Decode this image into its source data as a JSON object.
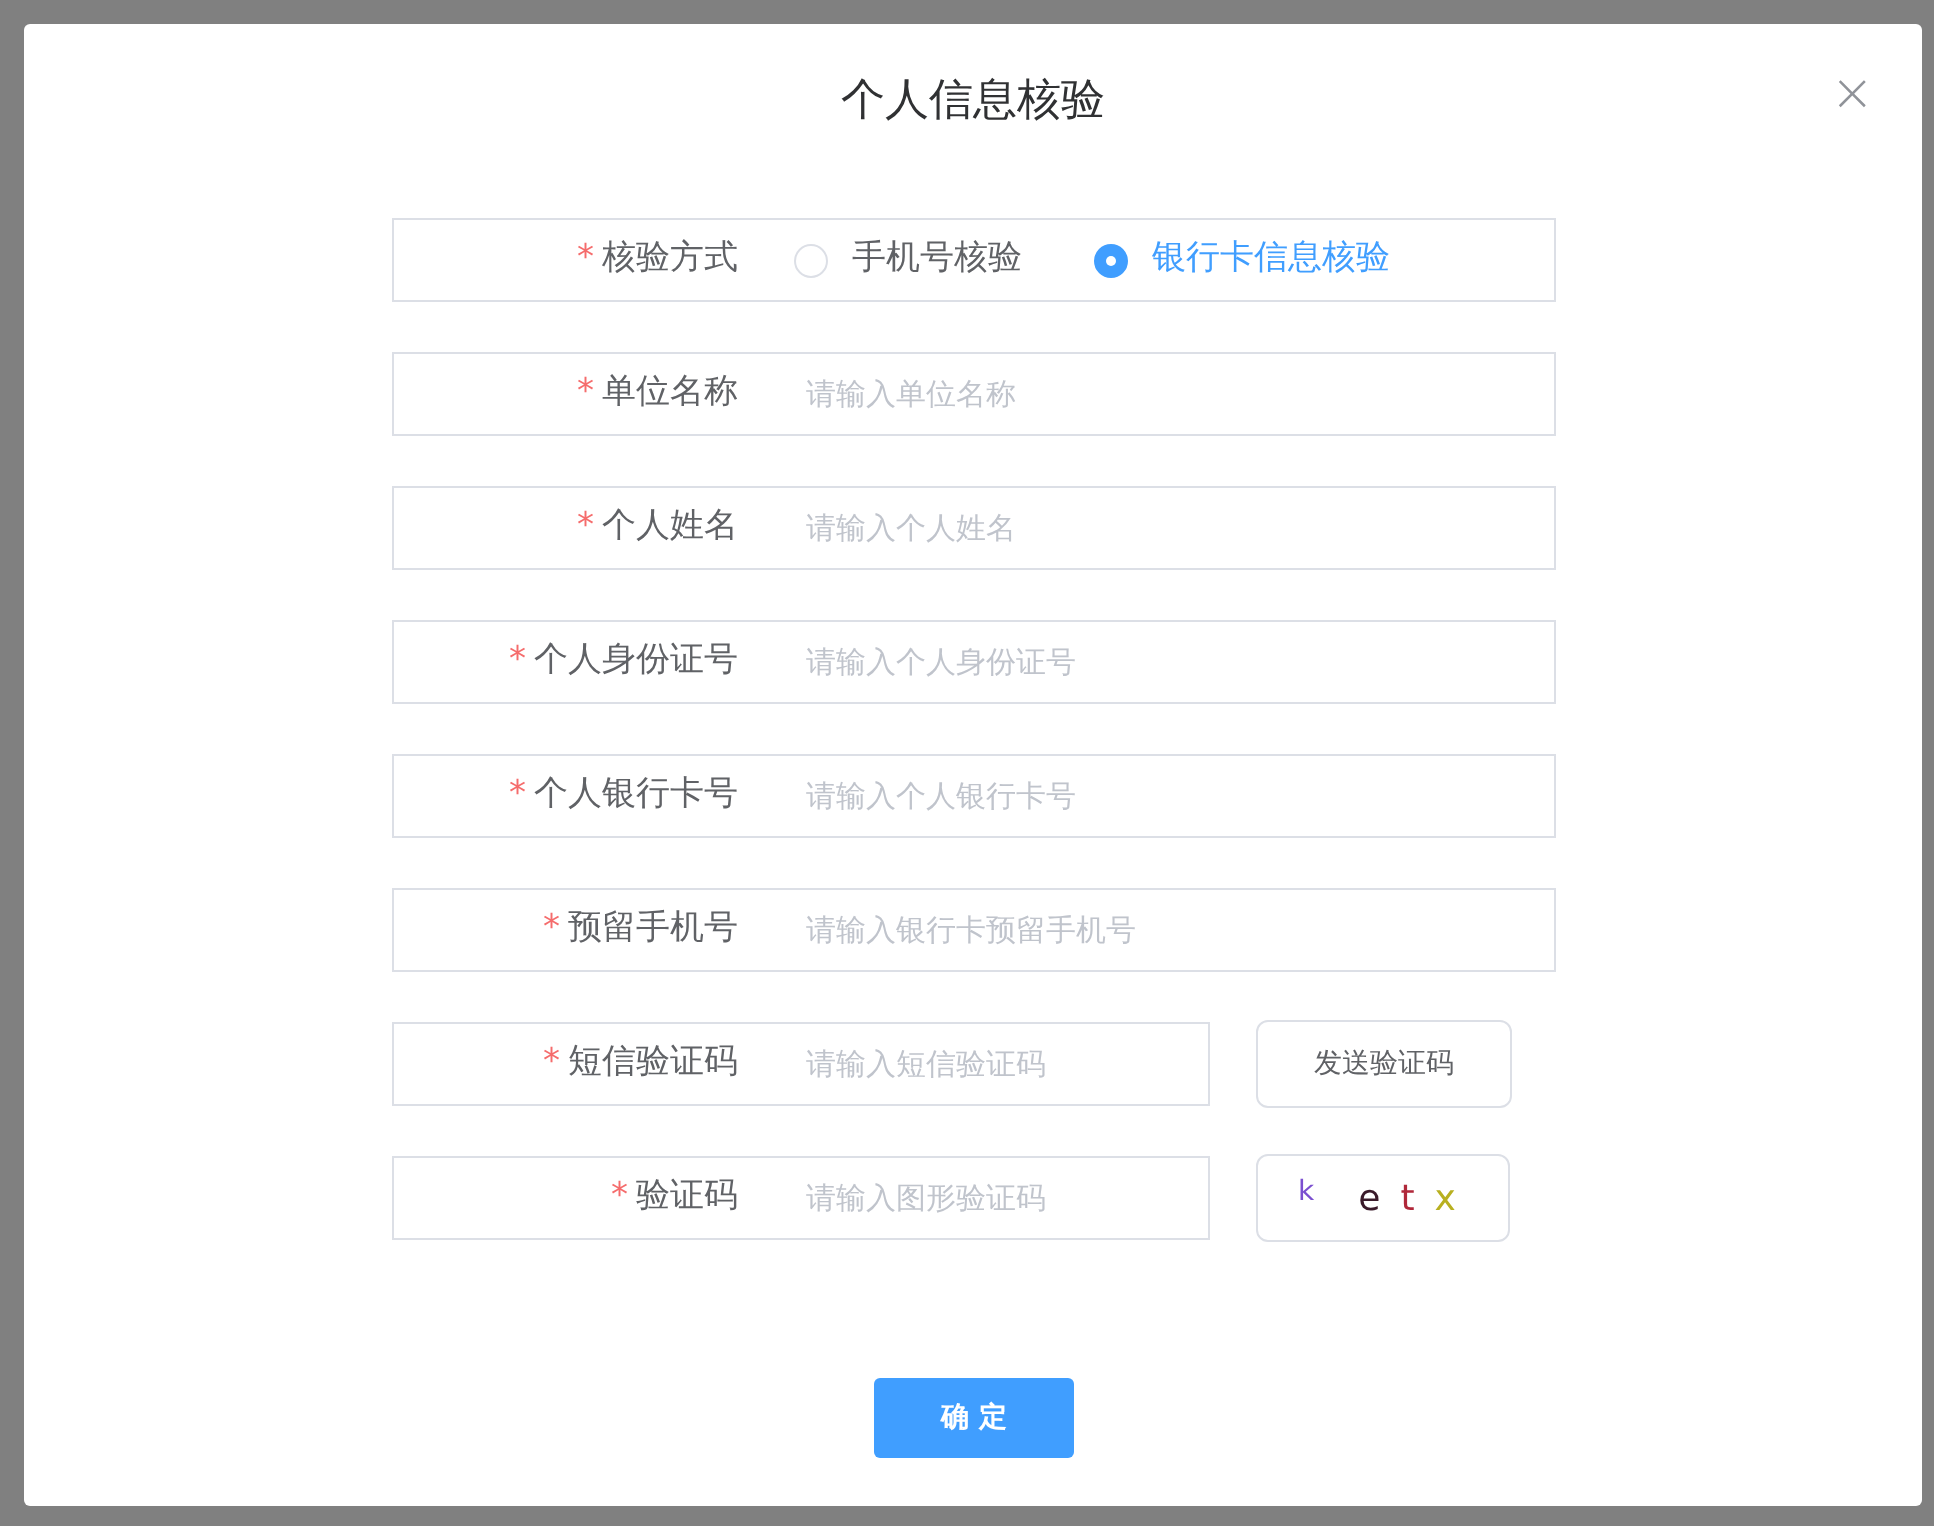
{
  "dialog": {
    "title": "个人信息核验",
    "close": "×"
  },
  "required_mark": "*",
  "fields": [
    {
      "kind": "radio",
      "label": "核验方式",
      "required": true,
      "options": [
        {
          "label": "手机号核验",
          "selected": false
        },
        {
          "label": "银行卡信息核验",
          "selected": true
        }
      ]
    },
    {
      "kind": "input",
      "label": "单位名称",
      "required": true,
      "placeholder": "请输入单位名称"
    },
    {
      "kind": "input",
      "label": "个人姓名",
      "required": true,
      "placeholder": "请输入个人姓名"
    },
    {
      "kind": "input",
      "label": "个人身份证号",
      "required": true,
      "placeholder": "请输入个人身份证号"
    },
    {
      "kind": "input",
      "label": "个人银行卡号",
      "required": true,
      "placeholder": "请输入个人银行卡号"
    },
    {
      "kind": "input",
      "label": "预留手机号",
      "required": true,
      "placeholder": "请输入银行卡预留手机号"
    },
    {
      "kind": "sms",
      "label": "短信验证码",
      "required": true,
      "placeholder": "请输入短信验证码",
      "button": "发送验证码"
    },
    {
      "kind": "captcha",
      "label": "验证码",
      "required": true,
      "placeholder": "请输入图形验证码",
      "captcha": [
        {
          "text": "k",
          "color": "#7b4fd0"
        },
        {
          "text": "e",
          "color": "#3a1a2a"
        },
        {
          "text": "t",
          "color": "#b0283a"
        },
        {
          "text": "x",
          "color": "#b8b020"
        }
      ]
    }
  ],
  "submit": "确 定"
}
